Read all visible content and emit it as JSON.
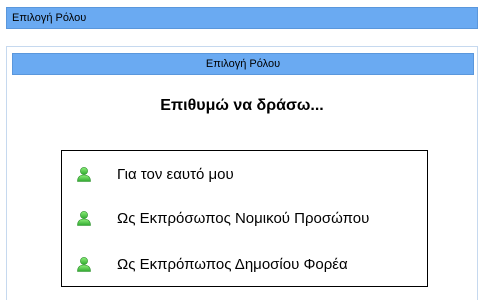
{
  "window": {
    "title": "Επιλογή Ρόλου"
  },
  "panel": {
    "header": "Επιλογή Ρόλου",
    "prompt": "Επιθυμώ να δράσω..."
  },
  "roles": [
    {
      "label": "Για τον εαυτό μου",
      "icon": "user-icon"
    },
    {
      "label": "Ως Εκπρόσωπος Νομικού Προσώπου",
      "icon": "user-icon"
    },
    {
      "label": "Ως Εκπρόπωπος Δημοσίου Φορέα",
      "icon": "user-icon"
    }
  ],
  "colors": {
    "header_bg": "#6aaaf2",
    "icon_green": "#4cc94c"
  }
}
